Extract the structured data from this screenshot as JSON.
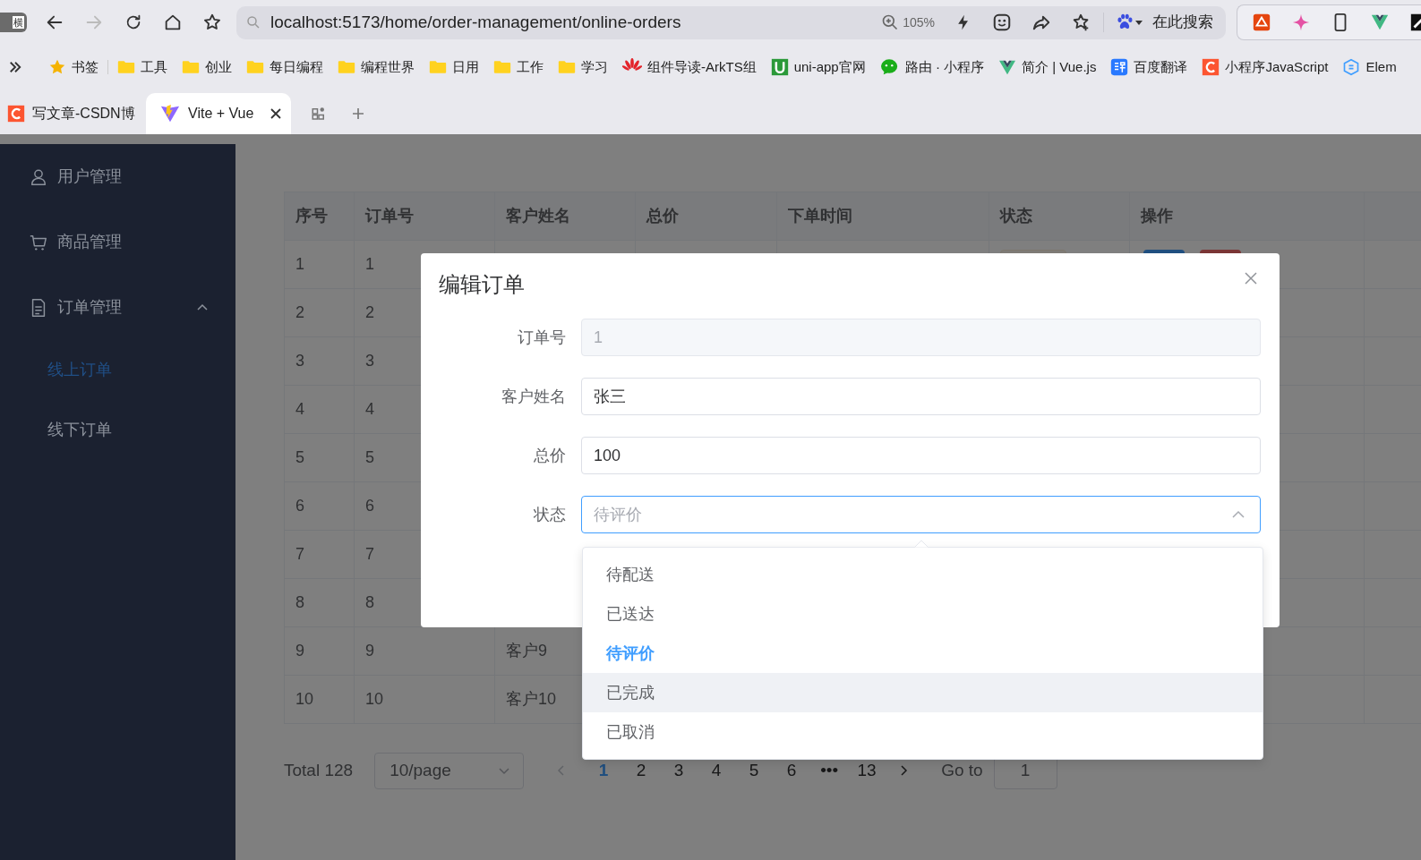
{
  "browser": {
    "window_badge": "横",
    "forward_disabled": true,
    "address": "localhost:5173/home/order-management/online-orders",
    "zoom": "105%",
    "search_placeholder": "在此搜索",
    "bookmarks": [
      {
        "kind": "star",
        "label": "书签"
      },
      {
        "kind": "folder",
        "label": "工具"
      },
      {
        "kind": "folder",
        "label": "创业"
      },
      {
        "kind": "folder",
        "label": "每日编程"
      },
      {
        "kind": "folder",
        "label": "编程世界"
      },
      {
        "kind": "folder",
        "label": "日用"
      },
      {
        "kind": "folder",
        "label": "工作"
      },
      {
        "kind": "folder",
        "label": "学习"
      },
      {
        "kind": "huawei",
        "label": "组件导读-ArkTS组"
      },
      {
        "kind": "uniapp",
        "label": "uni-app官网"
      },
      {
        "kind": "wechat",
        "label": "路由 · 小程序"
      },
      {
        "kind": "vue",
        "label": "简介 | Vue.js"
      },
      {
        "kind": "translate",
        "label": "百度翻译"
      },
      {
        "kind": "csdn",
        "label": "小程序JavaScript"
      },
      {
        "kind": "element",
        "label": "Elem"
      }
    ],
    "tabs": [
      {
        "kind": "csdn",
        "title": "写文章-CSDN博",
        "selected": false
      },
      {
        "kind": "vite",
        "title": "Vite + Vue",
        "selected": true
      }
    ]
  },
  "sidebar": {
    "items": [
      {
        "kind": "user",
        "label": "用户管理"
      },
      {
        "kind": "cart",
        "label": "商品管理"
      },
      {
        "kind": "document",
        "label": "订单管理",
        "expanded": true,
        "children": [
          {
            "label": "线上订单",
            "selected": true
          },
          {
            "label": "线下订单",
            "selected": false
          }
        ]
      }
    ]
  },
  "table": {
    "columns": [
      "序号",
      "订单号",
      "客户姓名",
      "总价",
      "下单时间",
      "状态",
      "操作"
    ],
    "rows": [
      [
        "1",
        "1"
      ],
      [
        "2",
        "2"
      ],
      [
        "3",
        "3"
      ],
      [
        "4",
        "4"
      ],
      [
        "5",
        "5"
      ],
      [
        "6",
        "6"
      ],
      [
        "7",
        "7"
      ],
      [
        "8",
        "8"
      ],
      [
        "9",
        "9",
        "客户9"
      ],
      [
        "10",
        "10",
        "客户10"
      ]
    ]
  },
  "pagination": {
    "total": "Total 128",
    "page_size": "10/page",
    "pages": [
      {
        "label": "1",
        "selected": true
      },
      {
        "label": "2",
        "selected": false
      },
      {
        "label": "3",
        "selected": false
      },
      {
        "label": "4",
        "selected": false
      },
      {
        "label": "5",
        "selected": false
      },
      {
        "label": "6",
        "selected": false
      },
      {
        "label": "•••",
        "selected": false
      },
      {
        "label": "13",
        "selected": false
      }
    ],
    "goto_label": "Go to",
    "goto_value": "1"
  },
  "dialog": {
    "title": "编辑订单",
    "fields": [
      {
        "kind": "text",
        "label": "订单号",
        "value": "1",
        "disabled": true
      },
      {
        "kind": "text",
        "label": "客户姓名",
        "value": "张三",
        "disabled": false
      },
      {
        "kind": "text",
        "label": "总价",
        "value": "100",
        "disabled": false
      },
      {
        "kind": "select",
        "label": "状态",
        "placeholder": "待评价",
        "expanded": true
      }
    ],
    "options": [
      {
        "label": "待配送",
        "selected": false,
        "hovered": false
      },
      {
        "label": "已送达",
        "selected": false,
        "hovered": false
      },
      {
        "label": "待评价",
        "selected": true,
        "hovered": false
      },
      {
        "label": "已完成",
        "selected": false,
        "hovered": true
      },
      {
        "label": "已取消",
        "selected": false,
        "hovered": false
      }
    ]
  }
}
